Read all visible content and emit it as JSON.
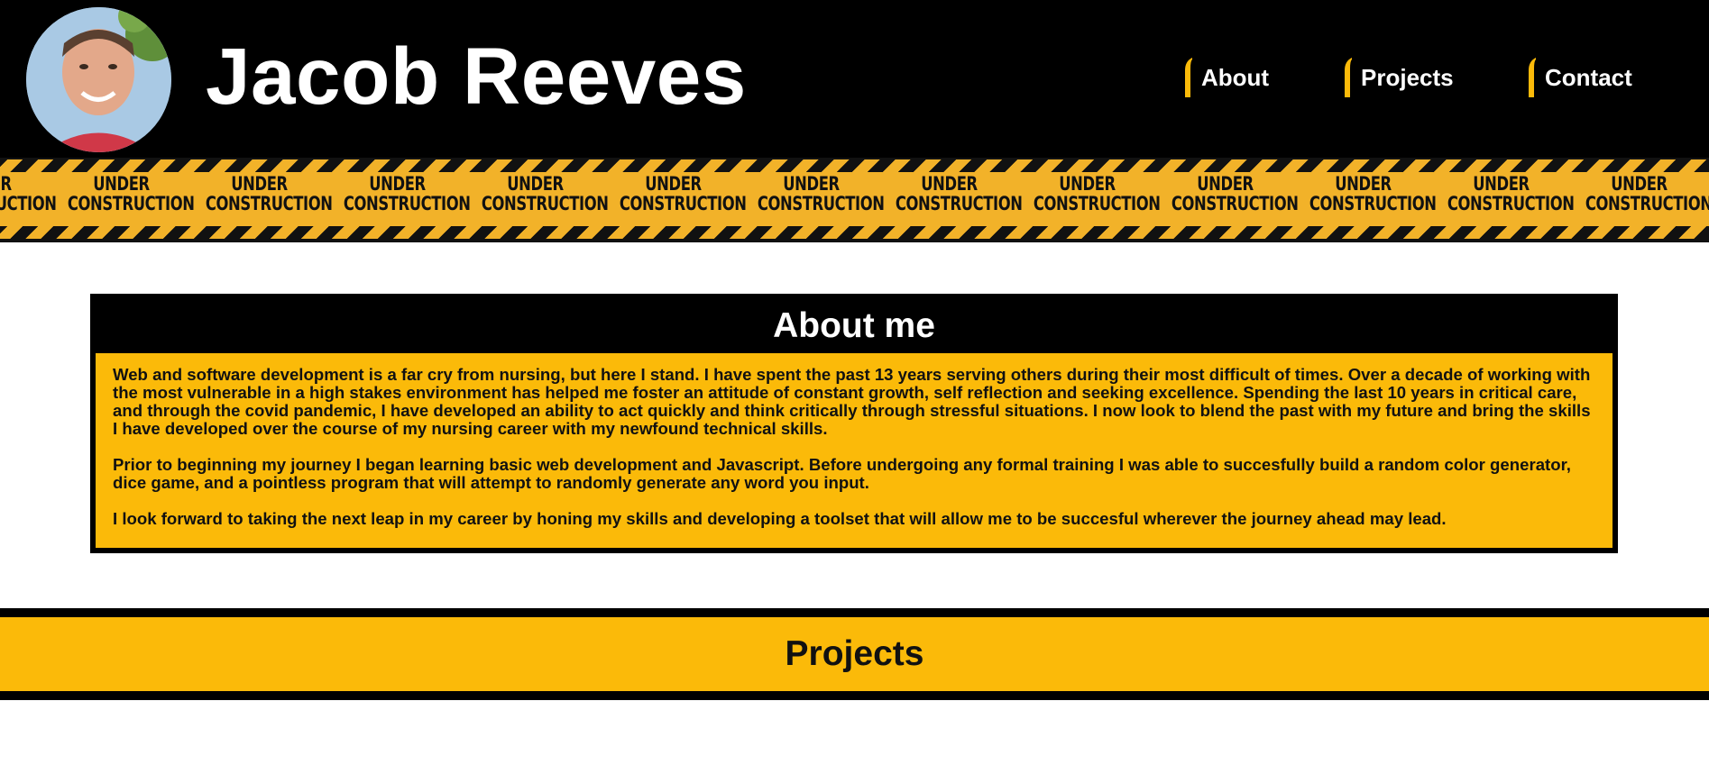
{
  "header": {
    "title": "Jacob Reeves",
    "avatar_icon": "profile-photo",
    "nav": [
      {
        "label": "About"
      },
      {
        "label": "Projects"
      },
      {
        "label": "Contact"
      }
    ]
  },
  "banner": {
    "line1": "UNDER",
    "line2": "CONSTRUCTION"
  },
  "about": {
    "title": "About me",
    "paragraphs": [
      "Web and software development is a far cry from nursing, but here I stand. I have spent the past 13 years serving others during their most difficult of times. Over a decade of working with the most vulnerable in a high stakes environment has helped me foster an attitude of constant growth, self reflection and seeking excellence. Spending the last 10 years in critical care, and through the covid pandemic, I have developed an ability to act quickly and think critically through stressful situations. I now look to blend the past with my future and bring the skills I have developed over the course of my nursing career with my newfound technical skills.",
      "Prior to beginning my journey I began learning basic web development and Javascript. Before undergoing any formal training I was able to succesfully build a random color generator, dice game, and a pointless program that will attempt to randomly generate any word you input.",
      "I look forward to taking the next leap in my career by honing my skills and developing a toolset that will allow me to be succesful wherever the journey ahead may lead."
    ]
  },
  "projects": {
    "title": "Projects"
  },
  "colors": {
    "accent": "#fbba09",
    "tape": "#f2b229",
    "dark": "#000000"
  }
}
